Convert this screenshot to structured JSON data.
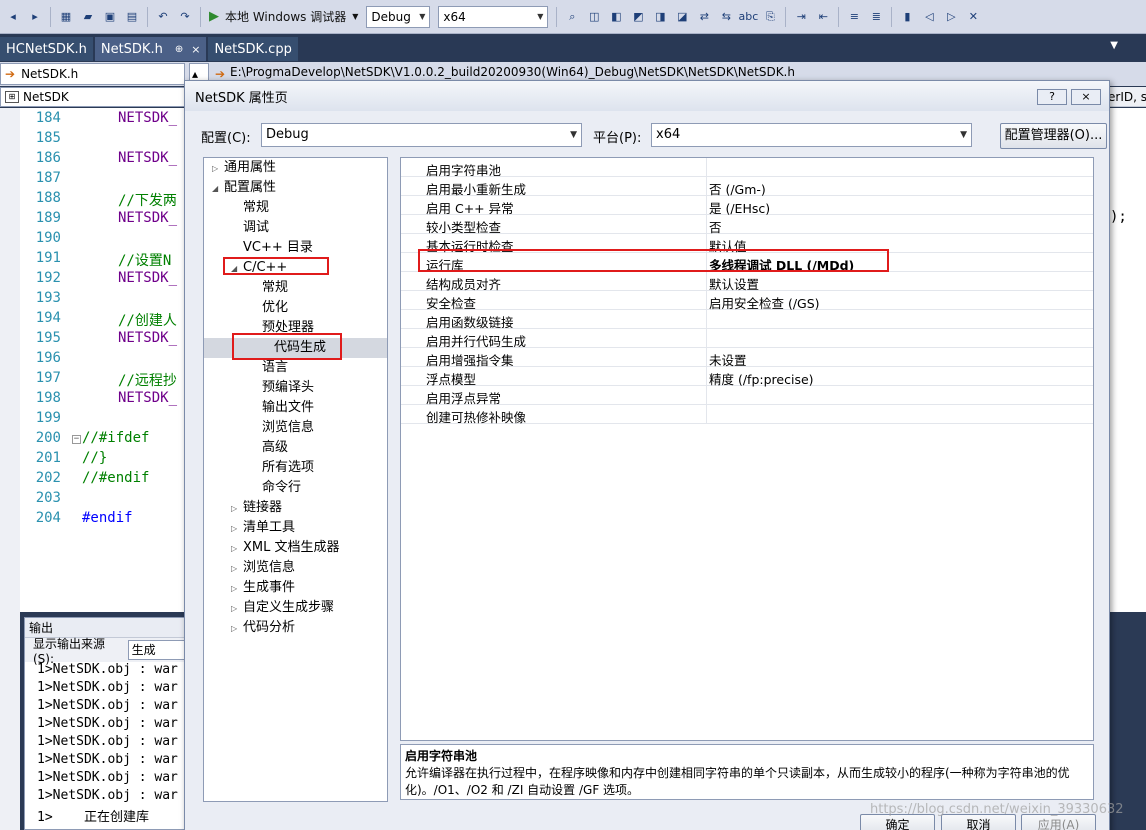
{
  "toolbar": {
    "run_label": "本地 Windows 调试器",
    "config_value": "Debug",
    "platform_value": "x64"
  },
  "tabs": [
    {
      "label": "HCNetSDK.h"
    },
    {
      "label": "NetSDK.h",
      "pin": "⊕",
      "close": "×"
    },
    {
      "label": "NetSDK.cpp"
    }
  ],
  "navbar": {
    "file_combo": "NetSDK.h",
    "path": "E:\\ProgmaDevelop\\NetSDK\\V1.0.0.2_build20200930(Win64)_Debug\\NetSDK\\NetSDK\\NetSDK.h",
    "class_combo": "NetSDK",
    "right_text": "erID, s"
  },
  "editor": {
    "lines": [
      {
        "num": "184",
        "text": "NETSDK_",
        "kind": "macro"
      },
      {
        "num": "185",
        "text": "",
        "kind": "macro"
      },
      {
        "num": "186",
        "text": "NETSDK_",
        "kind": "macro"
      },
      {
        "num": "187",
        "text": "",
        "kind": "macro"
      },
      {
        "num": "188",
        "text": "//下发两",
        "kind": "comment"
      },
      {
        "num": "189",
        "text": "NETSDK_",
        "kind": "macro"
      },
      {
        "num": "190",
        "text": "",
        "kind": "macro"
      },
      {
        "num": "191",
        "text": "//设置N",
        "kind": "comment"
      },
      {
        "num": "192",
        "text": "NETSDK_",
        "kind": "macro"
      },
      {
        "num": "193",
        "text": "",
        "kind": "macro"
      },
      {
        "num": "194",
        "text": "//创建人",
        "kind": "comment"
      },
      {
        "num": "195",
        "text": "NETSDK_",
        "kind": "macro"
      },
      {
        "num": "196",
        "text": "",
        "kind": "macro"
      },
      {
        "num": "197",
        "text": "//远程抄",
        "kind": "comment"
      },
      {
        "num": "198",
        "text": "NETSDK_",
        "kind": "macro"
      },
      {
        "num": "199",
        "text": "",
        "kind": "macro"
      },
      {
        "num": "200",
        "text": "//#ifdef",
        "kind": "comment",
        "fold": true
      },
      {
        "num": "201",
        "text": "//}",
        "kind": "comment"
      },
      {
        "num": "202",
        "text": "//#endif",
        "kind": "comment"
      },
      {
        "num": "203",
        "text": "",
        "kind": "macro"
      },
      {
        "num": "204",
        "text": "#endif",
        "kind": "pre"
      }
    ],
    "right_fragment": ");"
  },
  "output": {
    "title": "输出",
    "source_label": "显示输出来源(S):",
    "source_value": "生成",
    "lines": [
      "1>NetSDK.obj : war",
      "1>NetSDK.obj : war",
      "1>NetSDK.obj : war",
      "1>NetSDK.obj : war",
      "1>NetSDK.obj : war",
      "1>NetSDK.obj : war",
      "1>NetSDK.obj : war",
      "1>NetSDK.obj : war",
      "1>    正在创建库"
    ]
  },
  "dialog": {
    "title": "NetSDK 属性页",
    "help_btn": "?",
    "close_btn": "×",
    "config_label": "配置(C):",
    "config_value": "Debug",
    "platform_label": "平台(P):",
    "platform_value": "x64",
    "config_manager": "配置管理器(O)...",
    "tree": [
      {
        "label": "通用属性",
        "level": 0,
        "exp": "▷"
      },
      {
        "label": "配置属性",
        "level": 0,
        "exp": "◢"
      },
      {
        "label": "常规",
        "level": 1
      },
      {
        "label": "调试",
        "level": 1
      },
      {
        "label": "VC++ 目录",
        "level": 1
      },
      {
        "label": "C/C++",
        "level": 1,
        "exp": "◢"
      },
      {
        "label": "常规",
        "level": 2
      },
      {
        "label": "优化",
        "level": 2
      },
      {
        "label": "预处理器",
        "level": 2
      },
      {
        "label": "代码生成",
        "level": 2,
        "selected": true
      },
      {
        "label": "语言",
        "level": 2
      },
      {
        "label": "预编译头",
        "level": 2
      },
      {
        "label": "输出文件",
        "level": 2
      },
      {
        "label": "浏览信息",
        "level": 2
      },
      {
        "label": "高级",
        "level": 2
      },
      {
        "label": "所有选项",
        "level": 2
      },
      {
        "label": "命令行",
        "level": 2
      },
      {
        "label": "链接器",
        "level": 1,
        "exp": "▷"
      },
      {
        "label": "清单工具",
        "level": 1,
        "exp": "▷"
      },
      {
        "label": "XML 文档生成器",
        "level": 1,
        "exp": "▷"
      },
      {
        "label": "浏览信息",
        "level": 1,
        "exp": "▷"
      },
      {
        "label": "生成事件",
        "level": 1,
        "exp": "▷"
      },
      {
        "label": "自定义生成步骤",
        "level": 1,
        "exp": "▷"
      },
      {
        "label": "代码分析",
        "level": 1,
        "exp": "▷"
      }
    ],
    "grid": [
      {
        "name": "启用字符串池",
        "value": ""
      },
      {
        "name": "启用最小重新生成",
        "value": "否 (/Gm-)"
      },
      {
        "name": "启用 C++ 异常",
        "value": "是 (/EHsc)"
      },
      {
        "name": "较小类型检查",
        "value": "否"
      },
      {
        "name": "基本运行时检查",
        "value": "默认值"
      },
      {
        "name": "运行库",
        "value": "多线程调试 DLL (/MDd)",
        "highlight": true
      },
      {
        "name": "结构成员对齐",
        "value": "默认设置"
      },
      {
        "name": "安全检查",
        "value": "启用安全检查 (/GS)"
      },
      {
        "name": "启用函数级链接",
        "value": ""
      },
      {
        "name": "启用并行代码生成",
        "value": ""
      },
      {
        "name": "启用增强指令集",
        "value": "未设置"
      },
      {
        "name": "浮点模型",
        "value": "精度 (/fp:precise)"
      },
      {
        "name": "启用浮点异常",
        "value": ""
      },
      {
        "name": "创建可热修补映像",
        "value": ""
      }
    ],
    "description": {
      "title": "启用字符串池",
      "text": "允许编译器在执行过程中，在程序映像和内存中创建相同字符串的单个只读副本，从而生成较小的程序(一种称为字符串池的优化)。/O1、/O2 和 /ZI 自动设置 /GF 选项。"
    },
    "ok": "确定",
    "cancel": "取消",
    "apply": "应用(A)"
  },
  "watermark": "https://blog.csdn.net/weixin_39330632",
  "colors": {
    "annotation_red": "#e01b1b",
    "titlebar_dark": "#293955",
    "active_tab": "#fff6c7"
  }
}
